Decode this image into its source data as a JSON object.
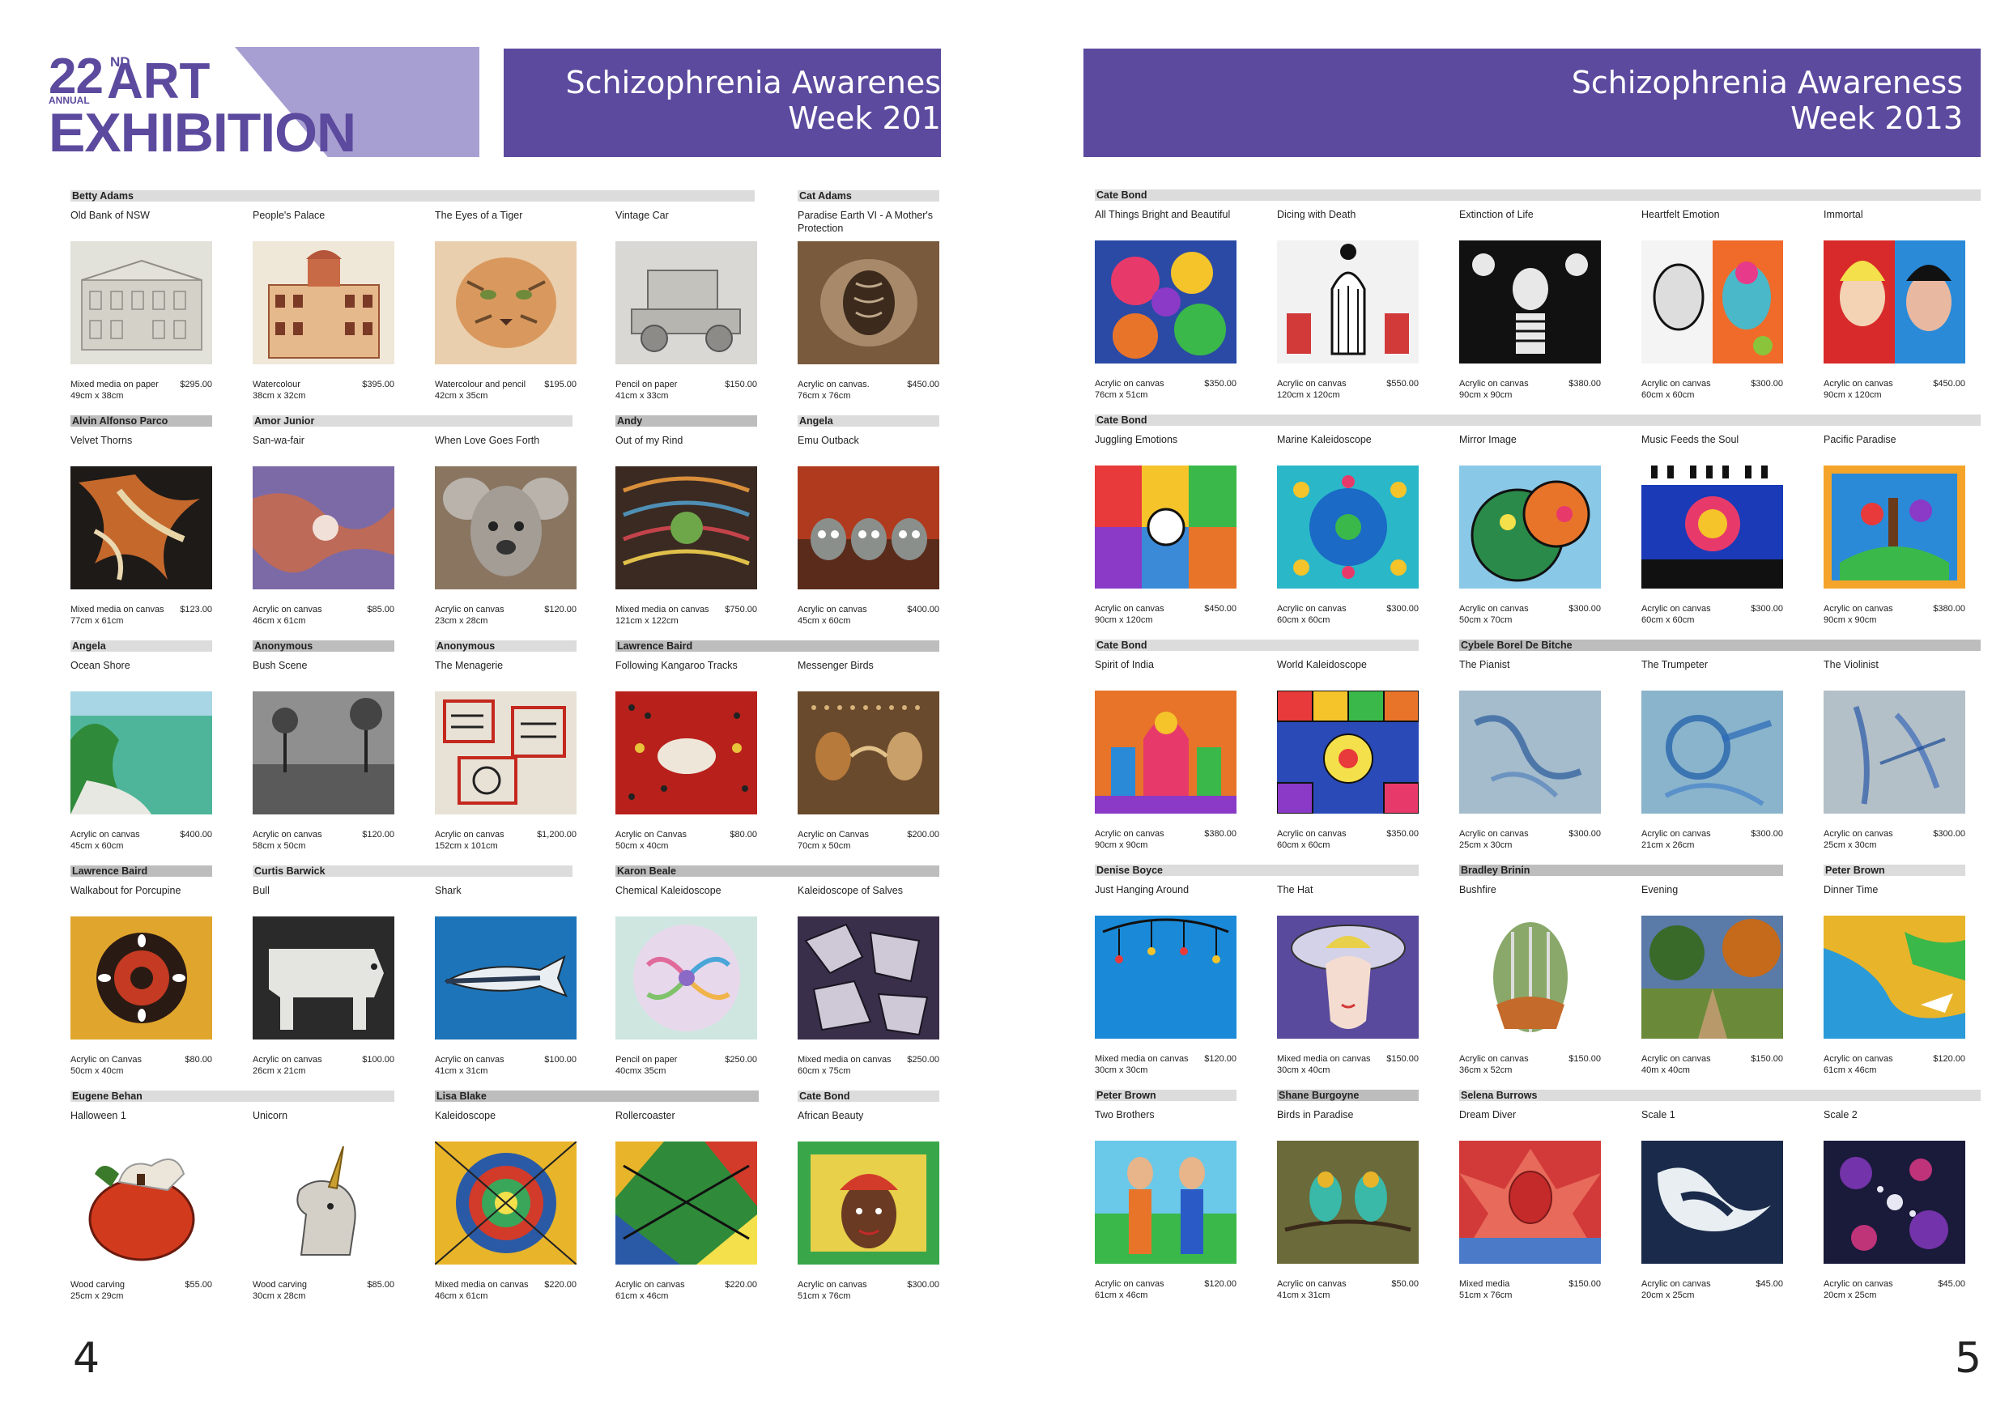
{
  "header": {
    "logo": {
      "number": "22",
      "superscript": "ND",
      "annual": "ANNUAL",
      "art": "ART",
      "exhibition": "EXHIBITION"
    },
    "banner_left": {
      "line1": "Schizophrenia Awarenes",
      "line2": "Week 201"
    },
    "banner_right": {
      "line1": "Schizophrenia Awareness",
      "line2": "Week 2013"
    }
  },
  "pages": {
    "left_number": "4",
    "right_number": "5"
  },
  "left": {
    "artists": [
      {
        "name": "Betty Adams"
      },
      {
        "name": "Cat  Adams"
      },
      {
        "name": "Alvin  Alfonso Parco"
      },
      {
        "name": "Amor Junior"
      },
      {
        "name": "Andy"
      },
      {
        "name": "Angela"
      },
      {
        "name": "Angela"
      },
      {
        "name": "Anonymous"
      },
      {
        "name": "Anonymous"
      },
      {
        "name": "Lawrence  Baird"
      },
      {
        "name": "Lawrence  Baird"
      },
      {
        "name": "Curtis  Barwick"
      },
      {
        "name": "Karon Beale"
      },
      {
        "name": "Eugene  Behan"
      },
      {
        "name": "Lisa  Blake"
      },
      {
        "name": "Cate  Bond"
      }
    ],
    "artworks": [
      {
        "title": "Old Bank of NSW",
        "medium": "Mixed media on paper",
        "size": "49cm x 38cm",
        "price": "$295.00"
      },
      {
        "title": "People's Palace",
        "medium": "Watercolour",
        "size": "38cm x 32cm",
        "price": "$395.00"
      },
      {
        "title": "The Eyes of a Tiger",
        "medium": "Watercolour and pencil",
        "size": "42cm x 35cm",
        "price": "$195.00"
      },
      {
        "title": "Vintage Car",
        "medium": "Pencil on paper",
        "size": "41cm x 33cm",
        "price": "$150.00"
      },
      {
        "title": "Paradise Earth VI - A Mother's Protection",
        "medium": "Acrylic on canvas.",
        "size": "76cm x 76cm",
        "price": "$450.00"
      },
      {
        "title": "Velvet Thorns",
        "medium": "Mixed media on canvas",
        "size": "77cm x 61cm",
        "price": "$123.00"
      },
      {
        "title": "San-wa-fair",
        "medium": "Acrylic on canvas",
        "size": "46cm x 61cm",
        "price": "$85.00"
      },
      {
        "title": "When Love Goes Forth",
        "medium": "Acrylic on canvas",
        "size": "23cm x 28cm",
        "price": "$120.00"
      },
      {
        "title": "Out of my Rind",
        "medium": "Mixed media on canvas",
        "size": "121cm x 122cm",
        "price": "$750.00"
      },
      {
        "title": "Emu Outback",
        "medium": "Acrylic on canvas",
        "size": "45cm x 60cm",
        "price": "$400.00"
      },
      {
        "title": "Ocean Shore",
        "medium": "Acrylic on canvas",
        "size": "45cm x 60cm",
        "price": "$400.00"
      },
      {
        "title": "Bush Scene",
        "medium": "Acrylic on canvas",
        "size": "58cm x 50cm",
        "price": "$120.00"
      },
      {
        "title": "The Menagerie",
        "medium": "Acrylic on canvas",
        "size": "152cm x 101cm",
        "price": "$1,200.00"
      },
      {
        "title": "Following Kangaroo Tracks",
        "medium": "Acrylic on Canvas",
        "size": "50cm x 40cm",
        "price": "$80.00"
      },
      {
        "title": "Messenger Birds",
        "medium": "Acrylic on Canvas",
        "size": "70cm x 50cm",
        "price": "$200.00"
      },
      {
        "title": "Walkabout for Porcupine",
        "medium": "Acrylic on Canvas",
        "size": "50cm x 40cm",
        "price": "$80.00"
      },
      {
        "title": "Bull",
        "medium": "Acrylic on canvas",
        "size": "26cm x 21cm",
        "price": "$100.00"
      },
      {
        "title": "Shark",
        "medium": "Acrylic on canvas",
        "size": "41cm x 31cm",
        "price": "$100.00"
      },
      {
        "title": "Chemical Kaleidoscope",
        "medium": "Pencil on paper",
        "size": "40cmx 35cm",
        "price": "$250.00"
      },
      {
        "title": "Kaleidoscope of Salves",
        "medium": "Mixed media on canvas",
        "size": "60cm x 75cm",
        "price": "$250.00"
      },
      {
        "title": "Halloween 1",
        "medium": "Wood carving",
        "size": "25cm x 29cm",
        "price": "$55.00"
      },
      {
        "title": "Unicorn",
        "medium": "Wood carving",
        "size": "30cm x 28cm",
        "price": "$85.00"
      },
      {
        "title": "Kaleidoscope",
        "medium": "Mixed media on canvas",
        "size": "46cm x 61cm",
        "price": "$220.00"
      },
      {
        "title": "Rollercoaster",
        "medium": "Acrylic on canvas",
        "size": "61cm x 46cm",
        "price": "$220.00"
      },
      {
        "title": "African Beauty",
        "medium": "Acrylic on canvas",
        "size": "51cm x 76cm",
        "price": "$300.00"
      }
    ]
  },
  "right": {
    "artists": [
      {
        "name": "Cate  Bond"
      },
      {
        "name": "Cate  Bond"
      },
      {
        "name": "Cate  Bond"
      },
      {
        "name": "Cybele  Borel De Bitche"
      },
      {
        "name": "Denise  Boyce"
      },
      {
        "name": "Bradley  Brinin"
      },
      {
        "name": "Peter  Brown"
      },
      {
        "name": "Peter  Brown"
      },
      {
        "name": "Shane  Burgoyne"
      },
      {
        "name": "Selena  Burrows"
      }
    ],
    "artworks": [
      {
        "title": "All Things Bright and Beautiful",
        "medium": "Acrylic on canvas",
        "size": "76cm x 51cm",
        "price": "$350.00"
      },
      {
        "title": "Dicing with Death",
        "medium": "Acrylic on canvas",
        "size": "120cm x 120cm",
        "price": "$550.00"
      },
      {
        "title": "Extinction of Life",
        "medium": "Acrylic on canvas",
        "size": "90cm x 90cm",
        "price": "$380.00"
      },
      {
        "title": "Heartfelt Emotion",
        "medium": "Acrylic on canvas",
        "size": "60cm x 60cm",
        "price": "$300.00"
      },
      {
        "title": "Immortal",
        "medium": "Acrylic on canvas",
        "size": "90cm x 120cm",
        "price": "$450.00"
      },
      {
        "title": "Juggling Emotions",
        "medium": "Acrylic on canvas",
        "size": "90cm x 120cm",
        "price": "$450.00"
      },
      {
        "title": "Marine Kaleidoscope",
        "medium": "Acrylic on canvas",
        "size": "60cm x 60cm",
        "price": "$300.00"
      },
      {
        "title": "Mirror Image",
        "medium": "Acrylic on canvas",
        "size": "50cm x 70cm",
        "price": "$300.00"
      },
      {
        "title": "Music Feeds the Soul",
        "medium": "Acrylic on canvas",
        "size": "60cm x 60cm",
        "price": "$300.00"
      },
      {
        "title": "Pacific Paradise",
        "medium": "Acrylic on canvas",
        "size": "90cm x 90cm",
        "price": "$380.00"
      },
      {
        "title": "Spirit of India",
        "medium": "Acrylic on canvas",
        "size": "90cm x 90cm",
        "price": "$380.00"
      },
      {
        "title": "World Kaleidoscope",
        "medium": "Acrylic on canvas",
        "size": "60cm x 60cm",
        "price": "$350.00"
      },
      {
        "title": "The Pianist",
        "medium": "Acrylic on canvas",
        "size": "25cm x 30cm",
        "price": "$300.00"
      },
      {
        "title": "The Trumpeter",
        "medium": "Acrylic on canvas",
        "size": "21cm x 26cm",
        "price": "$300.00"
      },
      {
        "title": "The Violinist",
        "medium": "Acrylic on canvas",
        "size": "25cm x 30cm",
        "price": "$300.00"
      },
      {
        "title": "Just Hanging Around",
        "medium": "Mixed media on canvas",
        "size": "30cm x 30cm",
        "price": "$120.00"
      },
      {
        "title": "The Hat",
        "medium": "Mixed media on canvas",
        "size": "30cm x 40cm",
        "price": "$150.00"
      },
      {
        "title": "Bushfire",
        "medium": "Acrylic on canvas",
        "size": "36cm x 52cm",
        "price": "$150.00"
      },
      {
        "title": "Evening",
        "medium": "Acrylic on canvas",
        "size": "40m x 40cm",
        "price": "$150.00"
      },
      {
        "title": "Dinner Time",
        "medium": "Acrylic on canvas",
        "size": "61cm x 46cm",
        "price": "$120.00"
      },
      {
        "title": "Two Brothers",
        "medium": "Acrylic on canvas",
        "size": "61cm x 46cm",
        "price": "$120.00"
      },
      {
        "title": "Birds in Paradise",
        "medium": "Acrylic on canvas",
        "size": "41cm x 31cm",
        "price": "$50.00"
      },
      {
        "title": "Dream Diver",
        "medium": "Mixed media",
        "size": "51cm x 76cm",
        "price": "$150.00"
      },
      {
        "title": "Scale 1",
        "medium": "Acrylic on canvas",
        "size": "20cm x 25cm",
        "price": "$45.00"
      },
      {
        "title": "Scale 2",
        "medium": "Acrylic on canvas",
        "size": "20cm x 25cm",
        "price": "$45.00"
      }
    ]
  }
}
